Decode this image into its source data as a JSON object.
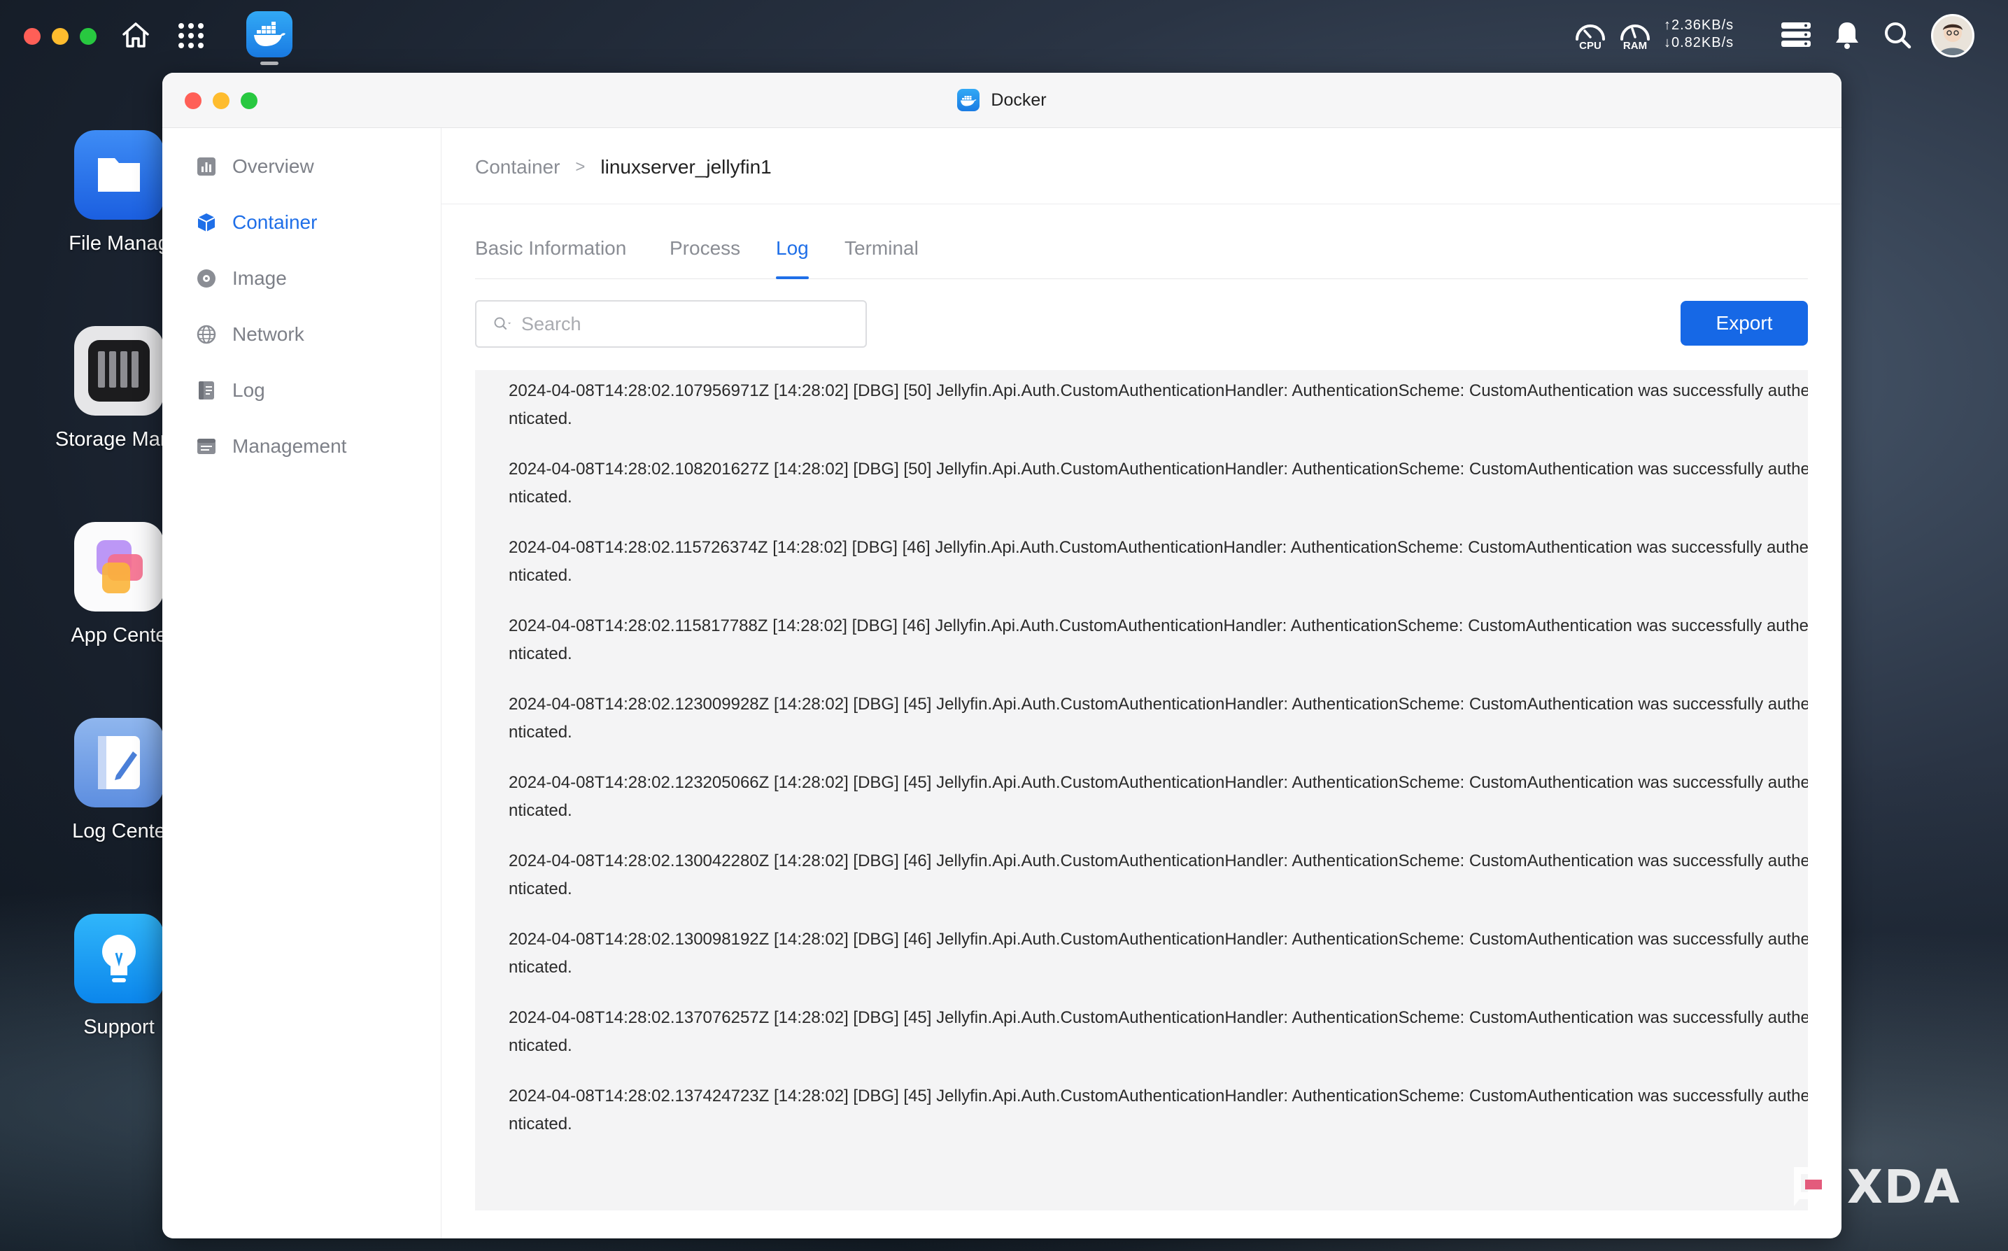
{
  "topbar": {
    "cpu_label": "CPU",
    "ram_label": "RAM",
    "upload_speed": "2.36KB/s",
    "download_speed": "0.82KB/s"
  },
  "desktop": {
    "icons": [
      {
        "label": "File Manag"
      },
      {
        "label": "Storage Mana"
      },
      {
        "label": "App Cente"
      },
      {
        "label": "Log Cente"
      },
      {
        "label": "Support"
      }
    ]
  },
  "window": {
    "title": "Docker"
  },
  "sidebar": {
    "items": [
      {
        "label": "Overview"
      },
      {
        "label": "Container"
      },
      {
        "label": "Image"
      },
      {
        "label": "Network"
      },
      {
        "label": "Log"
      },
      {
        "label": "Management"
      }
    ],
    "active": "Container"
  },
  "breadcrumb": {
    "parent": "Container",
    "separator": ">",
    "current": "linuxserver_jellyfin1"
  },
  "tabs": {
    "items": [
      {
        "label": "Basic Information"
      },
      {
        "label": "Process"
      },
      {
        "label": "Log"
      },
      {
        "label": "Terminal"
      }
    ],
    "active": "Log"
  },
  "search": {
    "placeholder": "Search",
    "value": ""
  },
  "export_label": "Export",
  "logs": [
    "2024-04-08T14:28:02.107956971Z [14:28:02] [DBG] [50] Jellyfin.Api.Auth.CustomAuthenticationHandler: AuthenticationScheme: CustomAuthentication was successfully authenticated.",
    "2024-04-08T14:28:02.108201627Z [14:28:02] [DBG] [50] Jellyfin.Api.Auth.CustomAuthenticationHandler: AuthenticationScheme: CustomAuthentication was successfully authenticated.",
    "2024-04-08T14:28:02.115726374Z [14:28:02] [DBG] [46] Jellyfin.Api.Auth.CustomAuthenticationHandler: AuthenticationScheme: CustomAuthentication was successfully authenticated.",
    "2024-04-08T14:28:02.115817788Z [14:28:02] [DBG] [46] Jellyfin.Api.Auth.CustomAuthenticationHandler: AuthenticationScheme: CustomAuthentication was successfully authenticated.",
    "2024-04-08T14:28:02.123009928Z [14:28:02] [DBG] [45] Jellyfin.Api.Auth.CustomAuthenticationHandler: AuthenticationScheme: CustomAuthentication was successfully authenticated.",
    "2024-04-08T14:28:02.123205066Z [14:28:02] [DBG] [45] Jellyfin.Api.Auth.CustomAuthenticationHandler: AuthenticationScheme: CustomAuthentication was successfully authenticated.",
    "2024-04-08T14:28:02.130042280Z [14:28:02] [DBG] [46] Jellyfin.Api.Auth.CustomAuthenticationHandler: AuthenticationScheme: CustomAuthentication was successfully authenticated.",
    "2024-04-08T14:28:02.130098192Z [14:28:02] [DBG] [46] Jellyfin.Api.Auth.CustomAuthenticationHandler: AuthenticationScheme: CustomAuthentication was successfully authenticated.",
    "2024-04-08T14:28:02.137076257Z [14:28:02] [DBG] [45] Jellyfin.Api.Auth.CustomAuthenticationHandler: AuthenticationScheme: CustomAuthentication was successfully authenticated.",
    "2024-04-08T14:28:02.137424723Z [14:28:02] [DBG] [45] Jellyfin.Api.Auth.CustomAuthenticationHandler: AuthenticationScheme: CustomAuthentication was successfully authenticated."
  ],
  "watermark": "XDA",
  "colors": {
    "accent": "#1f6fe8",
    "export_button": "#1668e6",
    "close": "#ff5f57",
    "minimize": "#febc2e",
    "zoom": "#28c840",
    "log_background": "#f4f4f5"
  },
  "icons": {
    "home": "home-icon",
    "apps": "grid-icon",
    "docker": "docker-icon",
    "cpu": "cpu-gauge-icon",
    "ram": "ram-gauge-icon",
    "tasks": "stack-icon",
    "notifications": "bell-icon",
    "search": "search-icon"
  }
}
